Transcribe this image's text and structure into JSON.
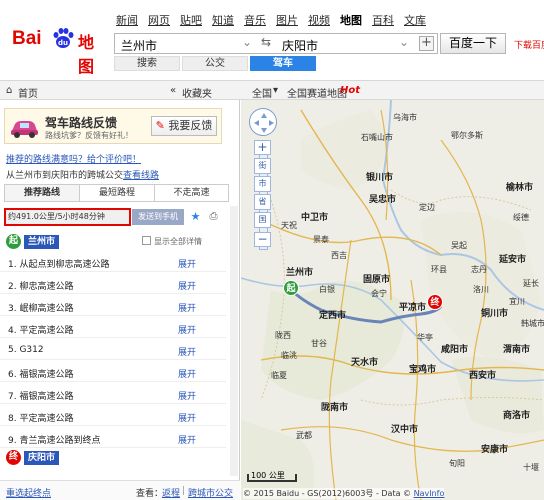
{
  "brand": {
    "bai": "Bai",
    "du": "du",
    "ditu": "地图"
  },
  "nav": {
    "items": [
      "新闻",
      "网页",
      "贴吧",
      "知道",
      "音乐",
      "图片",
      "视频",
      "地图",
      "百科",
      "文库"
    ],
    "active": "地图"
  },
  "route": {
    "from": "兰州市",
    "to": "庆阳市",
    "search_button": "百度一下",
    "broadcast": "下载百度地图"
  },
  "modes": [
    "搜索",
    "公交",
    "驾车"
  ],
  "breadcrumb": {
    "home": "首页",
    "collapse": "收藏夹",
    "area": "全国",
    "area_map": "全国赛道地图",
    "hot": "Hot"
  },
  "feedback": {
    "title": "驾车路线反馈",
    "subtitle": "路线坑爹？反馈有好礼！",
    "button": "我要反馈"
  },
  "prompt_link": "推荐的路线满意吗？给个评价吧！",
  "transit_line": {
    "prefix": "从兰州市到庆阳市的跨城公交",
    "link": "查看线路"
  },
  "tabs": [
    "推荐路线",
    "最短路程",
    "不走高速"
  ],
  "summary": {
    "text": "约491.0公里/5小时48分钟",
    "send": "发送到手机"
  },
  "start": {
    "badge": "起",
    "city": "兰州市",
    "show_all": "显示全部详情"
  },
  "steps": [
    {
      "text": "1.  从起点到柳忠高速公路",
      "action": "展开"
    },
    {
      "text": "2.  柳忠高速公路",
      "action": "展开"
    },
    {
      "text": "3.  岷柳高速公路",
      "action": "展开"
    },
    {
      "text": "4.  平定高速公路",
      "action": "展开"
    },
    {
      "text": "5.  G312",
      "action": "展开"
    },
    {
      "text": "6.  福银高速公路",
      "action": "展开"
    },
    {
      "text": "7.  福银高速公路",
      "action": "展开"
    },
    {
      "text": "8.  平定高速公路",
      "action": "展开"
    },
    {
      "text": "9.  青兰高速公路到终点",
      "action": "展开"
    }
  ],
  "end": {
    "badge": "终",
    "city": "庆阳市"
  },
  "footer": {
    "left_link": "重选起终点",
    "label": "查看：",
    "link1": "返程",
    "sep": "|",
    "link2": "跨城市公交"
  },
  "map": {
    "labels": {
      "wuhai": "乌海市",
      "shizuishan": "石嘴山市",
      "ejin": "鄂尔多斯",
      "yinchuan": "银川市",
      "yulin": "榆林市",
      "wuzhong": "吴忠市",
      "suide": "绥德",
      "zhongwei": "中卫市",
      "dingbian": "定边",
      "yan": "延安市",
      "xiji": "西吉",
      "guyuan": "固原市",
      "lanzhou": "兰州市",
      "dingxi": "定西市",
      "pingliang": "平凉市",
      "huining": "会宁",
      "longxi": "陇西",
      "tianshui": "天水市",
      "baoji": "宝鸡市",
      "xian": "西安市",
      "weinan": "渭南市",
      "tongchuan": "铜川市",
      "xianyang": "咸阳市",
      "hanzhong": "汉中市",
      "ankang": "安康市",
      "linxia": "临夏",
      "longnan": "陇南市",
      "wudu": "武都",
      "yanchang": "延长",
      "hancheng": "韩城市",
      "shangluo": "商洛市",
      "yunyang": "旬阳",
      "shiyan": "十堰",
      "huating": "华亭",
      "gangu": "甘谷",
      "tianzhu": "天祝",
      "jingtai": "景泰",
      "baiyin": "白银",
      "linxia2": "临洮",
      "huanxian": "环县",
      "wuqi": "吴起",
      "zhidan": "志丹",
      "luochuan": "洛川",
      "yichuan": "宜川"
    },
    "controls": {
      "zoom_in": "+",
      "zoom_out": "−",
      "level_street": "街",
      "level_city": "市",
      "level_province": "省",
      "level_country": "国"
    },
    "scale": "100 公里",
    "copyright": "© 2015 Baidu - GS(2012)6003号 - Data © ",
    "navinfo": "NavInfo",
    "pin_start": "起",
    "pin_end": "终"
  },
  "colors": {
    "brand_red": "#e10602",
    "brand_blue": "#2b57b8",
    "route": "#6a83b8",
    "start_green": "#2e9d3b"
  }
}
